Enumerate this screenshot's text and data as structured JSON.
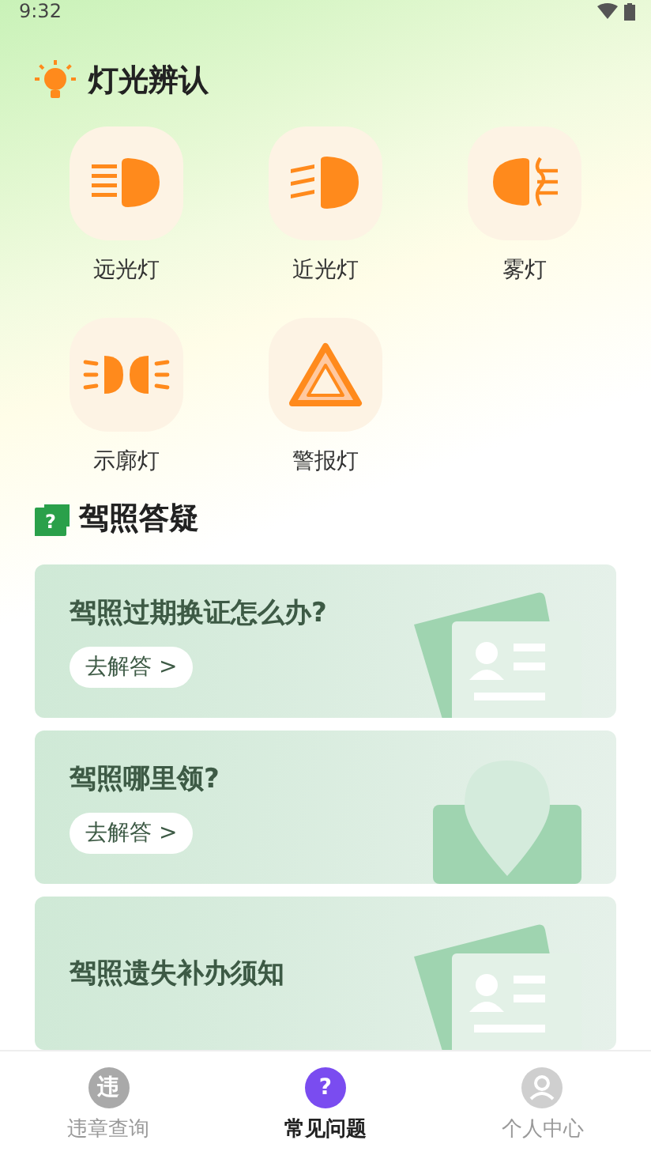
{
  "status_bar": {
    "time": "9:32"
  },
  "lights_section": {
    "title": "灯光辨认",
    "items": [
      {
        "kind": "high-beam",
        "label": "远光灯"
      },
      {
        "kind": "low-beam",
        "label": "近光灯"
      },
      {
        "kind": "fog",
        "label": "雾灯"
      },
      {
        "kind": "clearance",
        "label": "示廓灯"
      },
      {
        "kind": "hazard",
        "label": "警报灯"
      }
    ]
  },
  "faq_section": {
    "icon_char": "?",
    "title": "驾照答疑",
    "cards": [
      {
        "kind": "card",
        "question": "驾照过期换证怎么办?",
        "button": "去解答 >"
      },
      {
        "kind": "pin",
        "question": "驾照哪里领?",
        "button": "去解答 >"
      },
      {
        "kind": "card",
        "question": "驾照遗失补办须知"
      }
    ]
  },
  "bottom_nav": [
    {
      "kind": "violation",
      "icon_char": "违",
      "label": "违章查询",
      "selected": false
    },
    {
      "kind": "question",
      "icon_char": "?",
      "label": "常见问题",
      "selected": true
    },
    {
      "kind": "person",
      "label": "个人中心",
      "selected": false
    }
  ]
}
